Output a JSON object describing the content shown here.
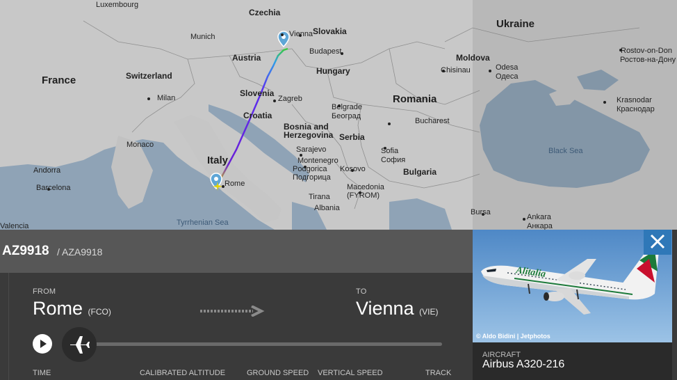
{
  "map": {
    "labels": [
      {
        "id": "luxembourg",
        "text": "Luxembourg",
        "kind": "city"
      },
      {
        "id": "czechia",
        "text": "Czechia",
        "kind": "region"
      },
      {
        "id": "ukraine",
        "text": "Ukraine",
        "kind": "country"
      },
      {
        "id": "munich",
        "text": "Munich",
        "kind": "city"
      },
      {
        "id": "slovakia",
        "text": "Slovakia",
        "kind": "region"
      },
      {
        "id": "vienna",
        "text": "Vienna",
        "kind": "city"
      },
      {
        "id": "france",
        "text": "France",
        "kind": "country"
      },
      {
        "id": "austria",
        "text": "Austria",
        "kind": "region"
      },
      {
        "id": "budapest",
        "text": "Budapest",
        "kind": "city"
      },
      {
        "id": "moldova",
        "text": "Moldova",
        "kind": "region"
      },
      {
        "id": "rostov",
        "text": "Rostov-on-Don",
        "kind": "city"
      },
      {
        "id": "rostov-ru",
        "text": "Ростов-на-Дону",
        "kind": "city"
      },
      {
        "id": "switzerland",
        "text": "Switzerland",
        "kind": "region"
      },
      {
        "id": "hungary",
        "text": "Hungary",
        "kind": "region"
      },
      {
        "id": "chisinau",
        "text": "Chisinau",
        "kind": "city"
      },
      {
        "id": "odesa",
        "text": "Odesa",
        "kind": "city"
      },
      {
        "id": "odesa-ua",
        "text": "Одеса",
        "kind": "city"
      },
      {
        "id": "slovenia",
        "text": "Slovenia",
        "kind": "region"
      },
      {
        "id": "milan",
        "text": "Milan",
        "kind": "city"
      },
      {
        "id": "zagreb",
        "text": "Zagreb",
        "kind": "city"
      },
      {
        "id": "romania",
        "text": "Romania",
        "kind": "country"
      },
      {
        "id": "krasnodar",
        "text": "Krasnodar",
        "kind": "city"
      },
      {
        "id": "krasnodar-ru",
        "text": "Краснодар",
        "kind": "city"
      },
      {
        "id": "croatia",
        "text": "Croatia",
        "kind": "region"
      },
      {
        "id": "belgrade",
        "text": "Belgrade",
        "kind": "city"
      },
      {
        "id": "beograd",
        "text": "Београд",
        "kind": "city"
      },
      {
        "id": "bosnia",
        "text": "Bosnia and",
        "kind": "region"
      },
      {
        "id": "herzegovina",
        "text": "Herzegovina",
        "kind": "region"
      },
      {
        "id": "bucharest",
        "text": "Bucharest",
        "kind": "city"
      },
      {
        "id": "serbia",
        "text": "Serbia",
        "kind": "region"
      },
      {
        "id": "monaco",
        "text": "Monaco",
        "kind": "city"
      },
      {
        "id": "sarajevo",
        "text": "Sarajevo",
        "kind": "city"
      },
      {
        "id": "black-sea",
        "text": "Black Sea",
        "kind": "sea"
      },
      {
        "id": "montenegro",
        "text": "Montenegro",
        "kind": "city"
      },
      {
        "id": "sofia",
        "text": "Sofia",
        "kind": "city"
      },
      {
        "id": "sofia-bg",
        "text": "София",
        "kind": "city"
      },
      {
        "id": "italy",
        "text": "Italy",
        "kind": "country"
      },
      {
        "id": "podgorica",
        "text": "Podgorica",
        "kind": "city"
      },
      {
        "id": "podgorica-cy",
        "text": "Подгорица",
        "kind": "city"
      },
      {
        "id": "kosovo",
        "text": "Kosovo",
        "kind": "city"
      },
      {
        "id": "andorra",
        "text": "Andorra",
        "kind": "city"
      },
      {
        "id": "bulgaria",
        "text": "Bulgaria",
        "kind": "region"
      },
      {
        "id": "rome",
        "text": "Rome",
        "kind": "city"
      },
      {
        "id": "barcelona",
        "text": "Barcelona",
        "kind": "city"
      },
      {
        "id": "macedonia",
        "text": "Macedonia",
        "kind": "city"
      },
      {
        "id": "fyrom",
        "text": "(FYROM)",
        "kind": "city"
      },
      {
        "id": "tirana",
        "text": "Tirana",
        "kind": "city"
      },
      {
        "id": "albania",
        "text": "Albania",
        "kind": "city"
      },
      {
        "id": "bursa",
        "text": "Bursa",
        "kind": "city"
      },
      {
        "id": "tyrrhenian",
        "text": "Tyrrhenian Sea",
        "kind": "sea"
      },
      {
        "id": "valencia",
        "text": "Valencia",
        "kind": "city"
      },
      {
        "id": "ankara",
        "text": "Ankara",
        "kind": "city"
      },
      {
        "id": "ankara-tr",
        "text": "Анкара",
        "kind": "city"
      }
    ]
  },
  "flight": {
    "callsign": "AZ9918",
    "icao_callsign": "/ AZA9918",
    "from_label": "FROM",
    "from_city": "Rome",
    "from_code": "(FCO)",
    "to_label": "TO",
    "to_city": "Vienna",
    "to_code": "(VIE)",
    "progress": 0
  },
  "stats": {
    "time": "TIME",
    "altitude": "CALIBRATED ALTITUDE",
    "ground_speed": "GROUND SPEED",
    "vertical_speed": "VERTICAL SPEED",
    "track": "TRACK"
  },
  "photo": {
    "credit": "© Aldo Bidini | Jetphotos",
    "aircraft_label": "AIRCRAFT",
    "aircraft_value": "Airbus A320-216",
    "livery_text": "Alitalia"
  },
  "colors": {
    "map_land": "#c9c9c9",
    "map_sea": "#8fa3b6",
    "panel_bg": "#3a3a3a",
    "header_bg": "#575757",
    "close_bg": "#2f78b8",
    "route_start": "#d6d200",
    "route_mid": "#6a1fd6",
    "route_end": "#2e9ee8"
  }
}
